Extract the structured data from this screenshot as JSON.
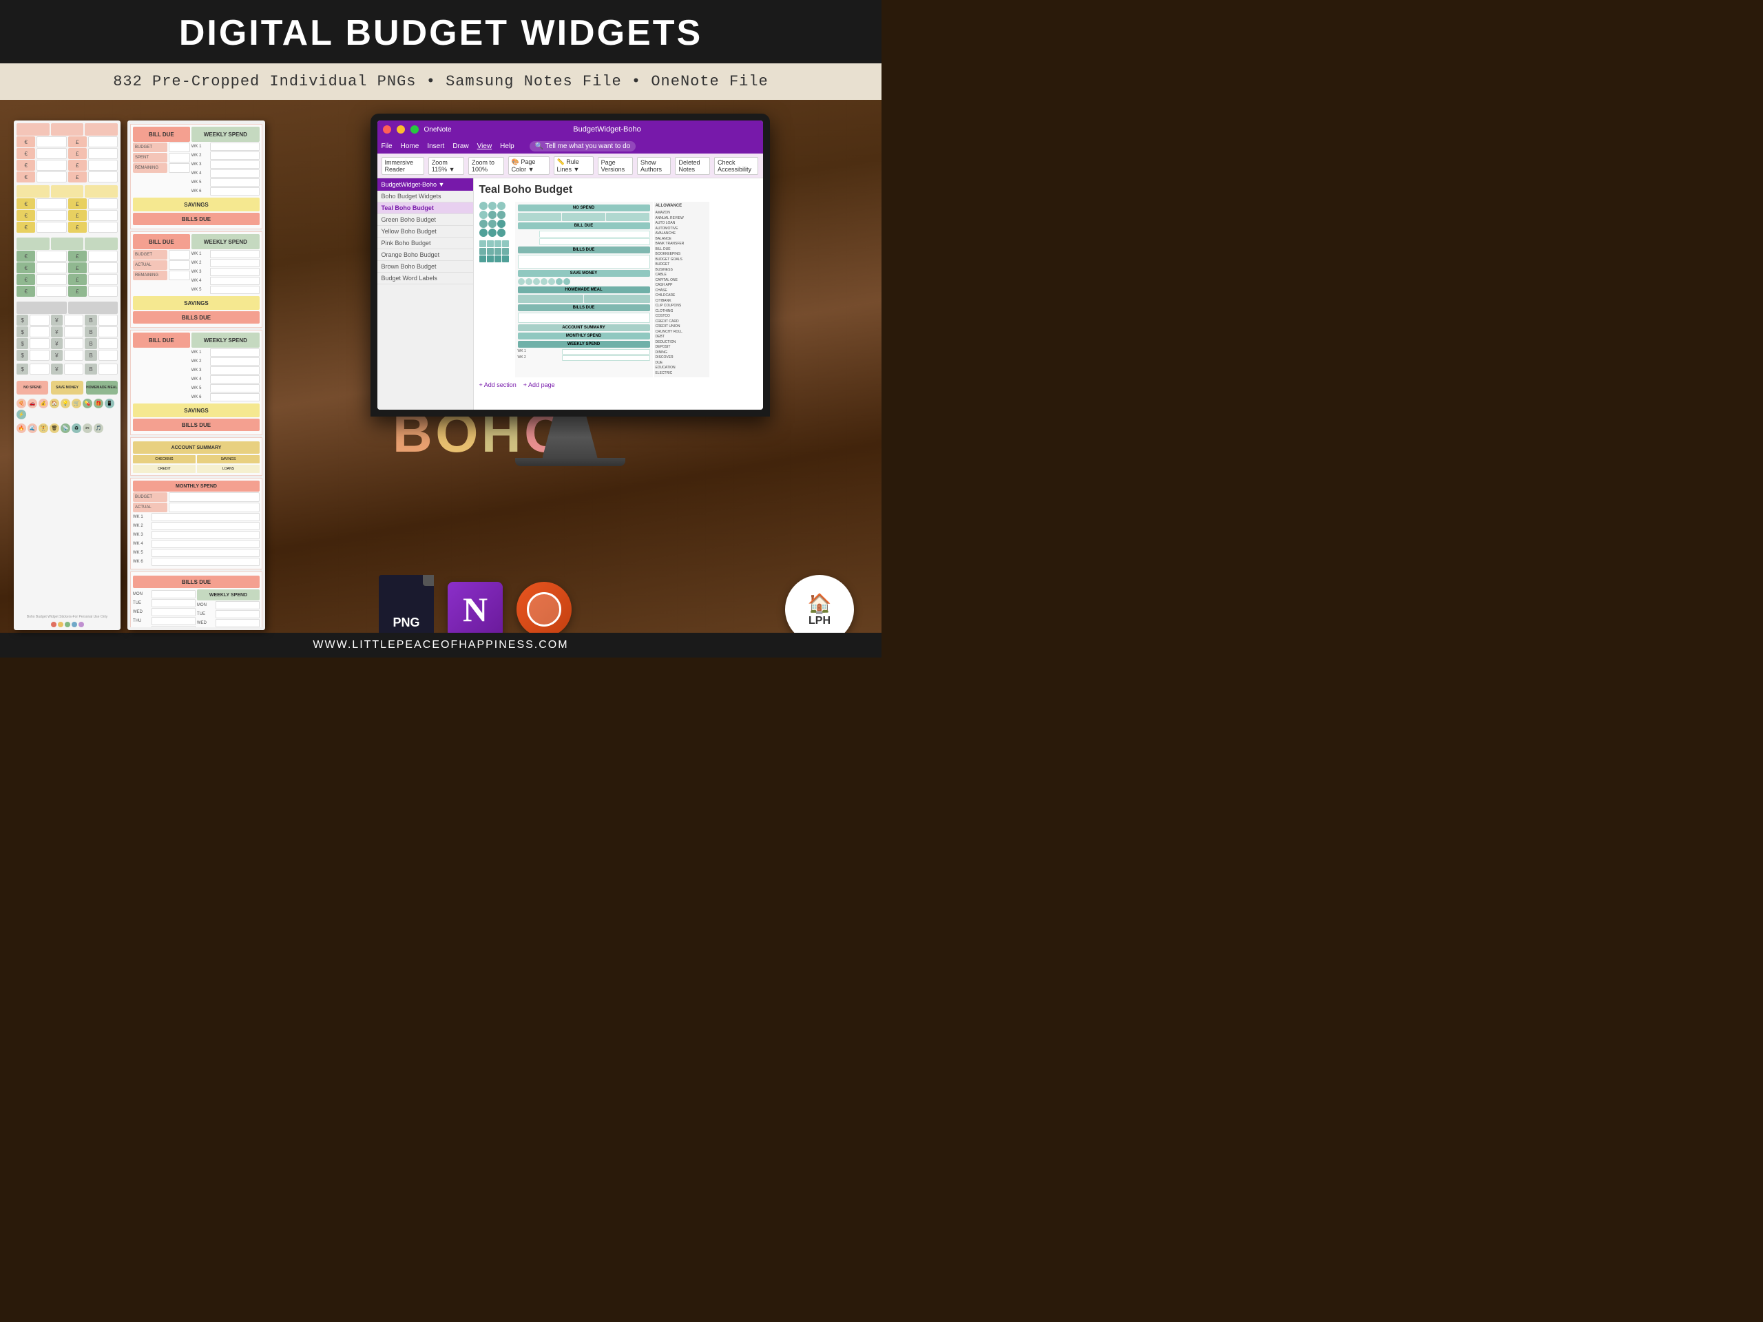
{
  "header": {
    "title": "DIGITAL BUDGET WIDGETS",
    "subtitle": "832 Pre-Cropped Individual PNGs • Samsung Notes File • OneNote File"
  },
  "onenote": {
    "title": "BudgetWidget-Boho",
    "menu_items": [
      "File",
      "Home",
      "Insert",
      "Draw",
      "View",
      "Help"
    ],
    "page_title": "Teal Boho Budget",
    "sections": [
      "Boho Budget Widgets",
      "Teal Boho Budget",
      "Green Boho Budget",
      "Yellow Boho Budget",
      "Pink Boho Budget",
      "Orange Boho Budget",
      "Brown Boho Budget",
      "Budget Word Labels"
    ]
  },
  "sheet1": {
    "sections": [
      "NO SPEND",
      "SAVE MONEY",
      "HOMEMADE MEAL"
    ]
  },
  "sheet2": {
    "sections": [
      "BILL DUE",
      "WEEKLY SPEND",
      "SAVINGS",
      "BILLS DUE",
      "ACCOUNT SUMMARY",
      "MONTHLY SPEND"
    ]
  },
  "boho_text": "BOHO",
  "file_formats": [
    "PNG",
    "N",
    "Samsung Notes"
  ],
  "footer": {
    "url": "WWW.LITTLEPEACEOFHAPPINESS.COM"
  },
  "lph": {
    "text": "LPH"
  },
  "colors": {
    "pink": "#f4a090",
    "yellow": "#e8d060",
    "green": "#90b890",
    "teal": "#70a8a0",
    "purple": "#7719aa",
    "orange": "#e85520",
    "wood_dark": "#3d2008",
    "wood_mid": "#6b4423"
  }
}
